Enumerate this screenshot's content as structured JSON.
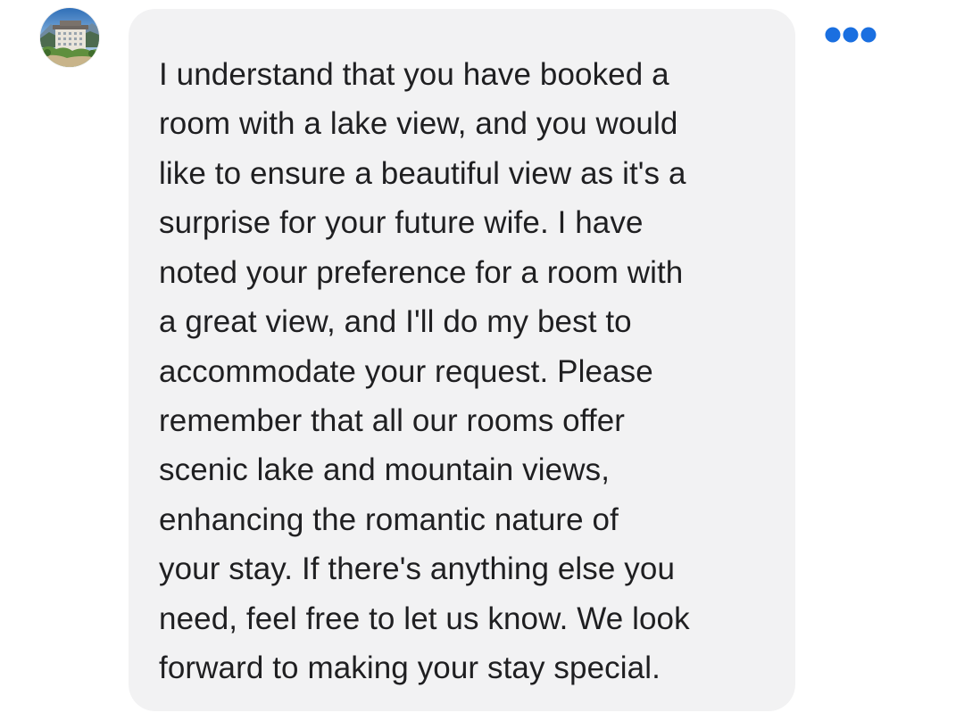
{
  "message": {
    "lines": [
      "I understand that you have booked a",
      "room with a lake view, and you would",
      "like to ensure a beautiful view as it's a",
      "surprise for your future wife. I have",
      "noted your preference for a room with",
      "a great view, and I'll do my best to",
      "accommodate your request. Please",
      "remember that all our rooms offer",
      "scenic lake and mountain views,",
      "enhancing the romantic nature of",
      "your stay. If there's anything else you",
      "need, feel free to let us know. We look",
      "forward to making your stay special."
    ]
  },
  "avatar": {
    "icon": "hotel-photo-avatar"
  },
  "actions": {
    "more_icon": "more-options-icon",
    "accent_color": "#1a6fe0"
  },
  "colors": {
    "bubble_background": "#f2f2f3",
    "text": "#1f1f21",
    "page_background": "#ffffff"
  }
}
